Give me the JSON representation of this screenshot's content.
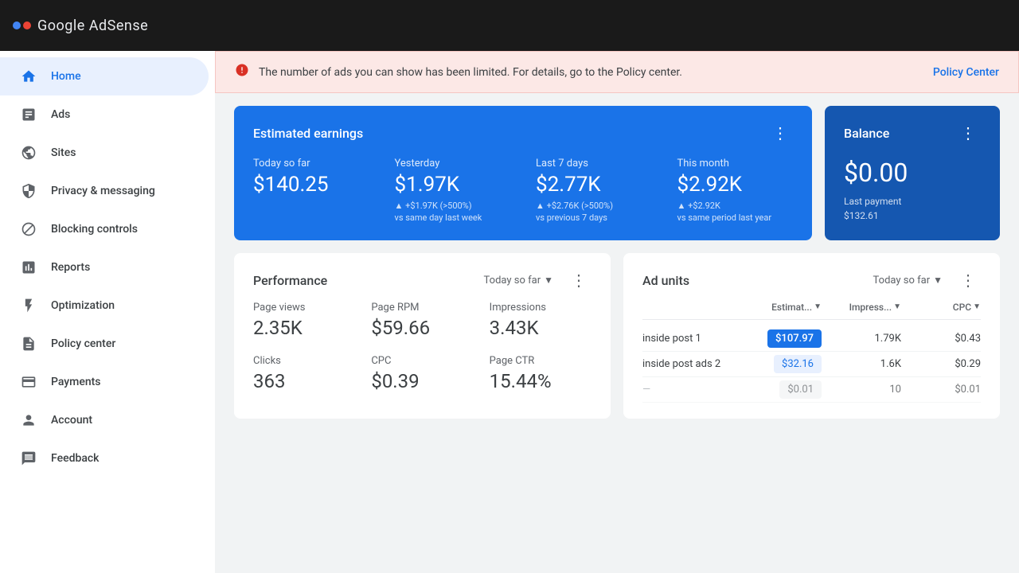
{
  "topbar": {
    "logo_text": "Google AdSense"
  },
  "sidebar": {
    "items": [
      {
        "id": "home",
        "label": "Home",
        "icon": "🏠",
        "active": true
      },
      {
        "id": "ads",
        "label": "Ads",
        "icon": "📋",
        "active": false
      },
      {
        "id": "sites",
        "label": "Sites",
        "icon": "🌐",
        "active": false
      },
      {
        "id": "privacy",
        "label": "Privacy & messaging",
        "icon": "🔒",
        "active": false
      },
      {
        "id": "blocking",
        "label": "Blocking controls",
        "icon": "🛡️",
        "active": false
      },
      {
        "id": "reports",
        "label": "Reports",
        "icon": "📈",
        "active": false
      },
      {
        "id": "optimization",
        "label": "Optimization",
        "icon": "⚡",
        "active": false
      },
      {
        "id": "policy",
        "label": "Policy center",
        "icon": "📄",
        "active": false
      },
      {
        "id": "payments",
        "label": "Payments",
        "icon": "💳",
        "active": false
      },
      {
        "id": "account",
        "label": "Account",
        "icon": "👤",
        "active": false
      },
      {
        "id": "feedback",
        "label": "Feedback",
        "icon": "💬",
        "active": false
      }
    ]
  },
  "alert": {
    "text": "The number of ads you can show has been limited. For details, go to the Policy center.",
    "link_text": "Policy Center"
  },
  "earnings_card": {
    "title": "Estimated earnings",
    "metrics": [
      {
        "label": "Today so far",
        "value": "$140.25",
        "change": "",
        "vs": ""
      },
      {
        "label": "Yesterday",
        "value": "$1.97K",
        "change": "▲ +$1.97K (>500%)",
        "vs": "vs same day last week"
      },
      {
        "label": "Last 7 days",
        "value": "$2.77K",
        "change": "▲ +$2.76K (>500%)",
        "vs": "vs previous 7 days"
      },
      {
        "label": "This month",
        "value": "$2.92K",
        "change": "▲ +$2.92K",
        "vs": "vs same period last year"
      }
    ]
  },
  "balance_card": {
    "title": "Balance",
    "value": "$0.00",
    "last_payment_label": "Last payment",
    "last_payment_value": "$132.61"
  },
  "performance_card": {
    "title": "Performance",
    "period": "Today so far",
    "metrics": [
      {
        "label": "Page views",
        "value": "2.35K"
      },
      {
        "label": "Page RPM",
        "value": "$59.66"
      },
      {
        "label": "Impressions",
        "value": "3.43K"
      },
      {
        "label": "Clicks",
        "value": "363"
      },
      {
        "label": "CPC",
        "value": "$0.39"
      },
      {
        "label": "Page CTR",
        "value": "15.44%"
      }
    ]
  },
  "ad_units_card": {
    "title": "Ad units",
    "period": "Today so far",
    "columns": [
      {
        "label": "Estimat...",
        "sort": true
      },
      {
        "label": "Impress...",
        "sort": true
      },
      {
        "label": "CPC",
        "sort": true
      }
    ],
    "rows": [
      {
        "name": "inside post 1",
        "estimate": "$107.97",
        "impressions": "1.79K",
        "cpc": "$0.43",
        "highlight": true
      },
      {
        "name": "inside post ads 2",
        "estimate": "$32.16",
        "impressions": "1.6K",
        "cpc": "$0.29",
        "highlight": false
      },
      {
        "name": "...",
        "estimate": "$0.01",
        "impressions": "10",
        "cpc": "$0.01",
        "highlight": false
      }
    ]
  }
}
